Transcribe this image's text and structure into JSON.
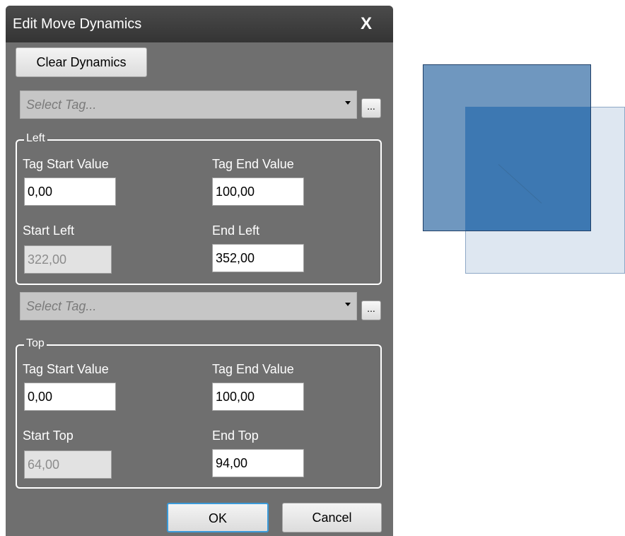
{
  "dialog": {
    "title": "Edit Move Dynamics",
    "close_glyph": "X",
    "clear_button": "Clear Dynamics",
    "left_tag": {
      "placeholder": "Select Tag...",
      "browse_label": "..."
    },
    "left_group": {
      "title": "Left",
      "tag_start_label": "Tag Start Value",
      "tag_start_value": "0,00",
      "tag_end_label": "Tag End Value",
      "tag_end_value": "100,00",
      "start_label": "Start Left",
      "start_value": "322,00",
      "end_label": "End Left",
      "end_value": "352,00"
    },
    "top_tag": {
      "placeholder": "Select Tag...",
      "browse_label": "..."
    },
    "top_group": {
      "title": "Top",
      "tag_start_label": "Tag Start Value",
      "tag_start_value": "0,00",
      "tag_end_label": "Tag End Value",
      "tag_end_value": "100,00",
      "start_label": "Start Top",
      "start_value": "64,00",
      "end_label": "End Top",
      "end_value": "94,00"
    },
    "ok_button": "OK",
    "cancel_button": "Cancel"
  },
  "colors": {
    "dialog_bg": "#6f6f6f",
    "titlebar": "#3c3c3c",
    "shape_fill": "#6f97bf",
    "shape_overlap": "#3d78b2",
    "ok_focus": "#3a9ad9"
  }
}
